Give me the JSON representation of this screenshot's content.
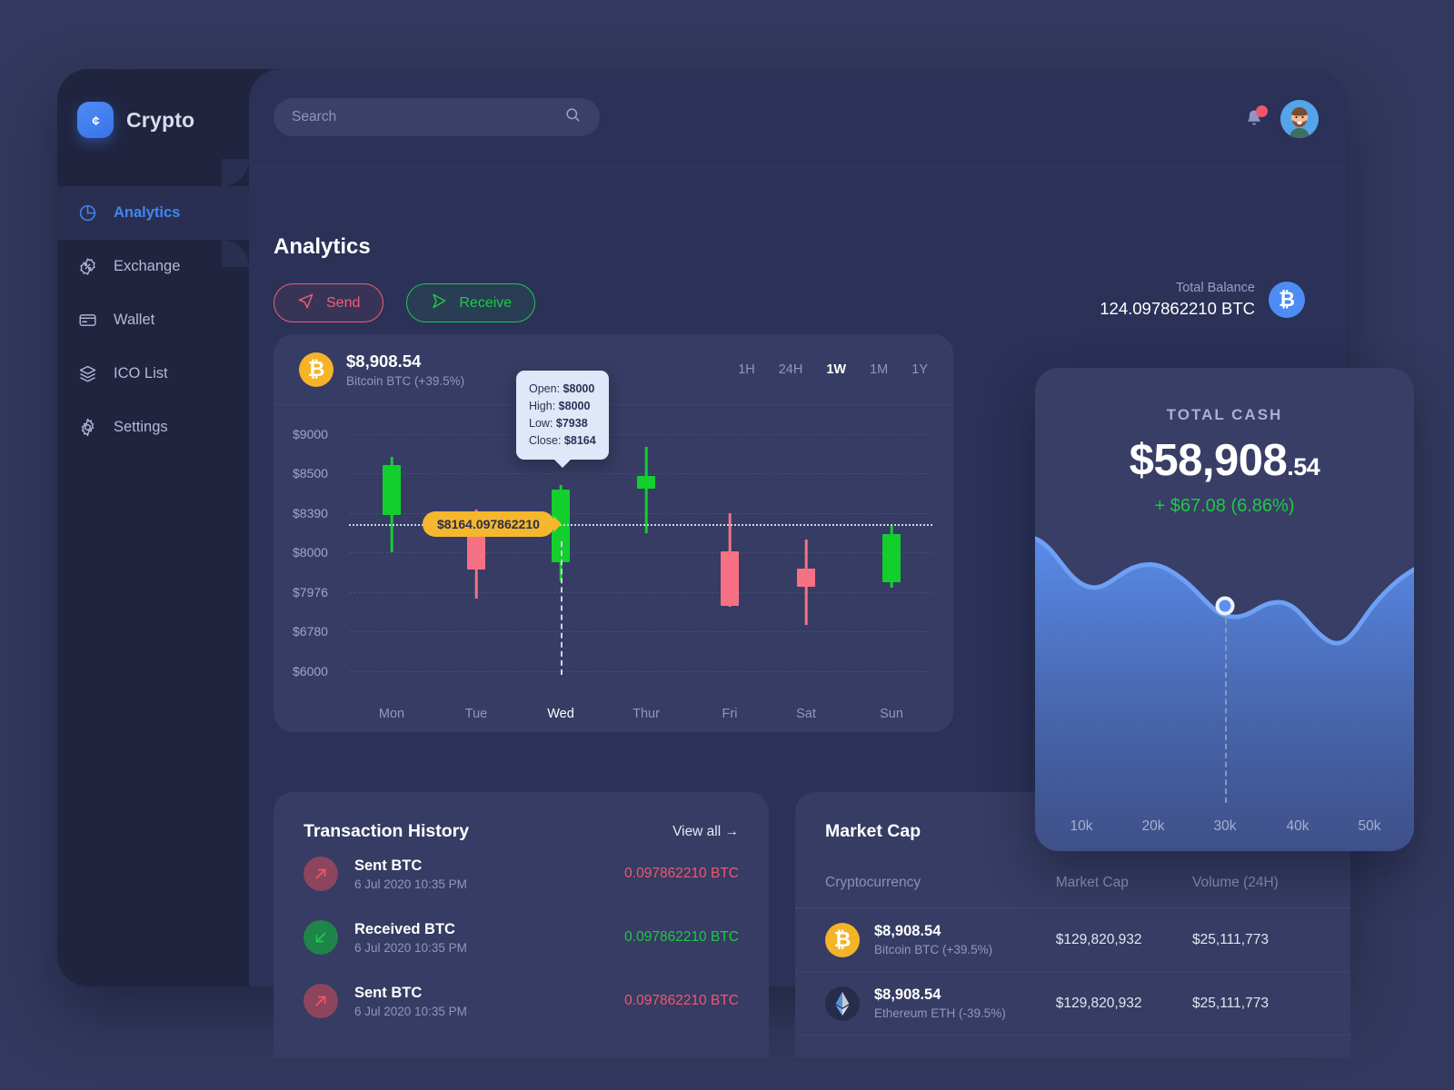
{
  "brand": {
    "name": "Crypto",
    "logo_icon": "crypto-coin-icon"
  },
  "sidebar": {
    "items": [
      {
        "label": "Analytics",
        "icon": "pie-chart-icon",
        "active": true
      },
      {
        "label": "Exchange",
        "icon": "percent-badge-icon",
        "active": false
      },
      {
        "label": "Wallet",
        "icon": "card-icon",
        "active": false
      },
      {
        "label": "ICO List",
        "icon": "layers-icon",
        "active": false
      },
      {
        "label": "Settings",
        "icon": "gear-icon",
        "active": false
      }
    ]
  },
  "topbar": {
    "search_placeholder": "Search",
    "search_value": "",
    "search_icon": "search-icon",
    "bell_icon": "notification-bell-icon",
    "avatar_icon": "user-avatar"
  },
  "page": {
    "title": "Analytics",
    "send_label": "Send",
    "receive_label": "Receive",
    "send_icon": "send-arrow-icon",
    "receive_icon": "receive-arrow-icon",
    "total_balance_label": "Total Balance",
    "total_balance_value": "124.097862210 BTC",
    "btc_symbol": "₿"
  },
  "chart_card": {
    "coin_symbol": "₿",
    "price": "$8,908.54",
    "subtitle": "Bitcoin BTC (+39.5%)",
    "ranges": [
      {
        "label": "1H",
        "active": false
      },
      {
        "label": "24H",
        "active": false
      },
      {
        "label": "1W",
        "active": true
      },
      {
        "label": "1M",
        "active": false
      },
      {
        "label": "1Y",
        "active": false
      }
    ],
    "tooltip": {
      "open_label": "Open:",
      "open_value": "$8000",
      "high_label": "High:",
      "high_value": "$8000",
      "low_label": "Low:",
      "low_value": "$7938",
      "close_label": "Close:",
      "close_value": "$8164"
    },
    "price_tag": "$8164.097862210"
  },
  "chart_data": {
    "type": "candlestick",
    "title": "Bitcoin BTC weekly candlestick",
    "xlabel": "",
    "ylabel": "",
    "categories": [
      "Mon",
      "Tue",
      "Wed",
      "Thur",
      "Fri",
      "Sat",
      "Sun"
    ],
    "y_ticks": [
      "$9000",
      "$8500",
      "$8390",
      "$8000",
      "$7976",
      "$6780",
      "$6000"
    ],
    "y_tick_values": [
      9000,
      8500,
      8390,
      8000,
      7976,
      6780,
      6000
    ],
    "highlight_price": 8164.09786221,
    "highlight_label": "$8164.097862210",
    "selected_category": "Wed",
    "grid": true,
    "candles": [
      {
        "x": "Mon",
        "open": 8400,
        "high": 8700,
        "low": 8250,
        "close": 8620,
        "direction": "up"
      },
      {
        "x": "Tue",
        "open": 8140,
        "high": 8160,
        "low": 7830,
        "close": 8000,
        "direction": "down"
      },
      {
        "x": "Wed",
        "open": 8000,
        "high": 8000,
        "low": 7938,
        "close": 8164,
        "direction": "up"
      },
      {
        "x": "Thur",
        "open": 8430,
        "high": 8560,
        "low": 8230,
        "close": 8470,
        "direction": "up"
      },
      {
        "x": "Fri",
        "open": 8000,
        "high": 8130,
        "low": 7700,
        "close": 7750,
        "direction": "down"
      },
      {
        "x": "Sat",
        "open": 7920,
        "high": 8060,
        "low": 7540,
        "close": 7880,
        "direction": "down"
      },
      {
        "x": "Sun",
        "open": 7800,
        "high": 8080,
        "low": 7760,
        "close": 7990,
        "direction": "up"
      }
    ]
  },
  "cash_card": {
    "label": "TOTAL CASH",
    "value_main": "$58,908",
    "value_cents": ".54",
    "delta": "+ $67.08 (6.86%)",
    "chart": {
      "type": "area",
      "x_ticks": [
        "10k",
        "20k",
        "30k",
        "40k",
        "50k"
      ],
      "x_tick_values": [
        10000,
        20000,
        30000,
        40000,
        50000
      ],
      "marker_x": "30k",
      "values": [
        88,
        62,
        68,
        74,
        62,
        47,
        47,
        60,
        62,
        40,
        38,
        62,
        78,
        84
      ]
    }
  },
  "transactions": {
    "title": "Transaction History",
    "view_all": "View all →",
    "rows": [
      {
        "name": "Sent BTC",
        "date": "6 Jul 2020 10:35 PM",
        "amount": "0.097862210 BTC",
        "type": "out",
        "icon": "arrow-up-right-icon"
      },
      {
        "name": "Received BTC",
        "date": "6 Jul 2020 10:35 PM",
        "amount": "0.097862210 BTC",
        "type": "in",
        "icon": "arrow-down-left-icon"
      },
      {
        "name": "Sent BTC",
        "date": "6 Jul 2020 10:35 PM",
        "amount": "0.097862210 BTC",
        "type": "out",
        "icon": "arrow-up-right-icon"
      }
    ]
  },
  "market_cap": {
    "title": "Market Cap",
    "headers": {
      "coin": "Cryptocurrency",
      "cap": "Market Cap",
      "vol": "Volume (24H)"
    },
    "rows": [
      {
        "icon": "bitcoin-icon",
        "symbol": "₿",
        "price": "$8,908.54",
        "sub": "Bitcoin BTC (+39.5%)",
        "cap": "$129,820,932",
        "vol": "$25,111,773"
      },
      {
        "icon": "ethereum-icon",
        "symbol": "",
        "price": "$8,908.54",
        "sub": "Ethereum ETH (-39.5%)",
        "cap": "$129,820,932",
        "vol": "$25,111,773"
      }
    ]
  },
  "colors": {
    "accent": "#4285f4",
    "up": "#13cf2d",
    "down": "#f77184",
    "warning": "#f5b72e",
    "bitcoin": "#f5b327",
    "page_bg": "#33395e",
    "sidebar_bg": "#20243f",
    "card_bg": "#363c63"
  }
}
